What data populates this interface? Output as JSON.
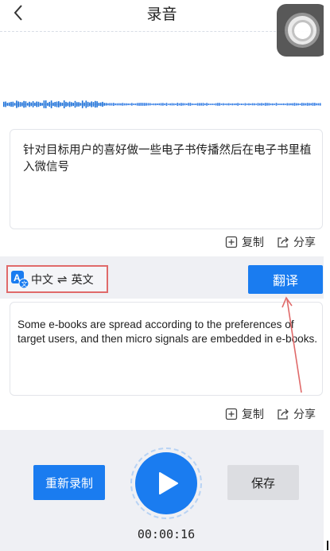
{
  "header": {
    "title": "录音"
  },
  "source": {
    "text": "针对目标用户的喜好做一些电子书传播然后在电子书里植入微信号",
    "copy_label": "复制",
    "share_label": "分享"
  },
  "language": {
    "from": "中文",
    "swap_symbol": "⇌",
    "to": "英文"
  },
  "translate_label": "翻译",
  "target": {
    "text": "Some e-books are spread according to the preferences of target users, and then micro signals are embedded in e-books.",
    "copy_label": "复制",
    "share_label": "分享"
  },
  "controls": {
    "rerecord_label": "重新录制",
    "save_label": "保存",
    "timer": "00:00:16"
  },
  "colors": {
    "accent": "#1a7cf0",
    "annotation": "#e06a6a"
  },
  "icons": {
    "back": "back-icon",
    "copy": "copy-icon",
    "share": "share-icon",
    "translate_lang": "translate-icon",
    "play": "play-icon",
    "assistive": "assistive-touch-icon"
  }
}
